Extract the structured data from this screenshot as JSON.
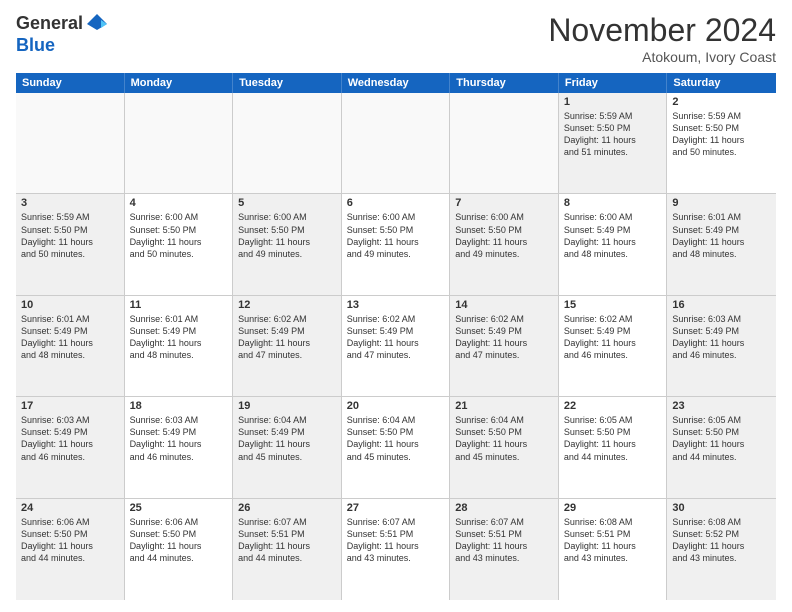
{
  "header": {
    "logo_line1": "General",
    "logo_line2": "Blue",
    "month": "November 2024",
    "location": "Atokoum, Ivory Coast"
  },
  "weekdays": [
    "Sunday",
    "Monday",
    "Tuesday",
    "Wednesday",
    "Thursday",
    "Friday",
    "Saturday"
  ],
  "rows": [
    [
      {
        "day": "",
        "info": "",
        "empty": true
      },
      {
        "day": "",
        "info": "",
        "empty": true
      },
      {
        "day": "",
        "info": "",
        "empty": true
      },
      {
        "day": "",
        "info": "",
        "empty": true
      },
      {
        "day": "",
        "info": "",
        "empty": true
      },
      {
        "day": "1",
        "info": "Sunrise: 5:59 AM\nSunset: 5:50 PM\nDaylight: 11 hours\nand 51 minutes.",
        "shaded": true
      },
      {
        "day": "2",
        "info": "Sunrise: 5:59 AM\nSunset: 5:50 PM\nDaylight: 11 hours\nand 50 minutes.",
        "shaded": false
      }
    ],
    [
      {
        "day": "3",
        "info": "Sunrise: 5:59 AM\nSunset: 5:50 PM\nDaylight: 11 hours\nand 50 minutes.",
        "shaded": true
      },
      {
        "day": "4",
        "info": "Sunrise: 6:00 AM\nSunset: 5:50 PM\nDaylight: 11 hours\nand 50 minutes.",
        "shaded": false
      },
      {
        "day": "5",
        "info": "Sunrise: 6:00 AM\nSunset: 5:50 PM\nDaylight: 11 hours\nand 49 minutes.",
        "shaded": true
      },
      {
        "day": "6",
        "info": "Sunrise: 6:00 AM\nSunset: 5:50 PM\nDaylight: 11 hours\nand 49 minutes.",
        "shaded": false
      },
      {
        "day": "7",
        "info": "Sunrise: 6:00 AM\nSunset: 5:50 PM\nDaylight: 11 hours\nand 49 minutes.",
        "shaded": true
      },
      {
        "day": "8",
        "info": "Sunrise: 6:00 AM\nSunset: 5:49 PM\nDaylight: 11 hours\nand 48 minutes.",
        "shaded": false
      },
      {
        "day": "9",
        "info": "Sunrise: 6:01 AM\nSunset: 5:49 PM\nDaylight: 11 hours\nand 48 minutes.",
        "shaded": true
      }
    ],
    [
      {
        "day": "10",
        "info": "Sunrise: 6:01 AM\nSunset: 5:49 PM\nDaylight: 11 hours\nand 48 minutes.",
        "shaded": true
      },
      {
        "day": "11",
        "info": "Sunrise: 6:01 AM\nSunset: 5:49 PM\nDaylight: 11 hours\nand 48 minutes.",
        "shaded": false
      },
      {
        "day": "12",
        "info": "Sunrise: 6:02 AM\nSunset: 5:49 PM\nDaylight: 11 hours\nand 47 minutes.",
        "shaded": true
      },
      {
        "day": "13",
        "info": "Sunrise: 6:02 AM\nSunset: 5:49 PM\nDaylight: 11 hours\nand 47 minutes.",
        "shaded": false
      },
      {
        "day": "14",
        "info": "Sunrise: 6:02 AM\nSunset: 5:49 PM\nDaylight: 11 hours\nand 47 minutes.",
        "shaded": true
      },
      {
        "day": "15",
        "info": "Sunrise: 6:02 AM\nSunset: 5:49 PM\nDaylight: 11 hours\nand 46 minutes.",
        "shaded": false
      },
      {
        "day": "16",
        "info": "Sunrise: 6:03 AM\nSunset: 5:49 PM\nDaylight: 11 hours\nand 46 minutes.",
        "shaded": true
      }
    ],
    [
      {
        "day": "17",
        "info": "Sunrise: 6:03 AM\nSunset: 5:49 PM\nDaylight: 11 hours\nand 46 minutes.",
        "shaded": true
      },
      {
        "day": "18",
        "info": "Sunrise: 6:03 AM\nSunset: 5:49 PM\nDaylight: 11 hours\nand 46 minutes.",
        "shaded": false
      },
      {
        "day": "19",
        "info": "Sunrise: 6:04 AM\nSunset: 5:49 PM\nDaylight: 11 hours\nand 45 minutes.",
        "shaded": true
      },
      {
        "day": "20",
        "info": "Sunrise: 6:04 AM\nSunset: 5:50 PM\nDaylight: 11 hours\nand 45 minutes.",
        "shaded": false
      },
      {
        "day": "21",
        "info": "Sunrise: 6:04 AM\nSunset: 5:50 PM\nDaylight: 11 hours\nand 45 minutes.",
        "shaded": true
      },
      {
        "day": "22",
        "info": "Sunrise: 6:05 AM\nSunset: 5:50 PM\nDaylight: 11 hours\nand 44 minutes.",
        "shaded": false
      },
      {
        "day": "23",
        "info": "Sunrise: 6:05 AM\nSunset: 5:50 PM\nDaylight: 11 hours\nand 44 minutes.",
        "shaded": true
      }
    ],
    [
      {
        "day": "24",
        "info": "Sunrise: 6:06 AM\nSunset: 5:50 PM\nDaylight: 11 hours\nand 44 minutes.",
        "shaded": true
      },
      {
        "day": "25",
        "info": "Sunrise: 6:06 AM\nSunset: 5:50 PM\nDaylight: 11 hours\nand 44 minutes.",
        "shaded": false
      },
      {
        "day": "26",
        "info": "Sunrise: 6:07 AM\nSunset: 5:51 PM\nDaylight: 11 hours\nand 44 minutes.",
        "shaded": true
      },
      {
        "day": "27",
        "info": "Sunrise: 6:07 AM\nSunset: 5:51 PM\nDaylight: 11 hours\nand 43 minutes.",
        "shaded": false
      },
      {
        "day": "28",
        "info": "Sunrise: 6:07 AM\nSunset: 5:51 PM\nDaylight: 11 hours\nand 43 minutes.",
        "shaded": true
      },
      {
        "day": "29",
        "info": "Sunrise: 6:08 AM\nSunset: 5:51 PM\nDaylight: 11 hours\nand 43 minutes.",
        "shaded": false
      },
      {
        "day": "30",
        "info": "Sunrise: 6:08 AM\nSunset: 5:52 PM\nDaylight: 11 hours\nand 43 minutes.",
        "shaded": true
      }
    ]
  ]
}
